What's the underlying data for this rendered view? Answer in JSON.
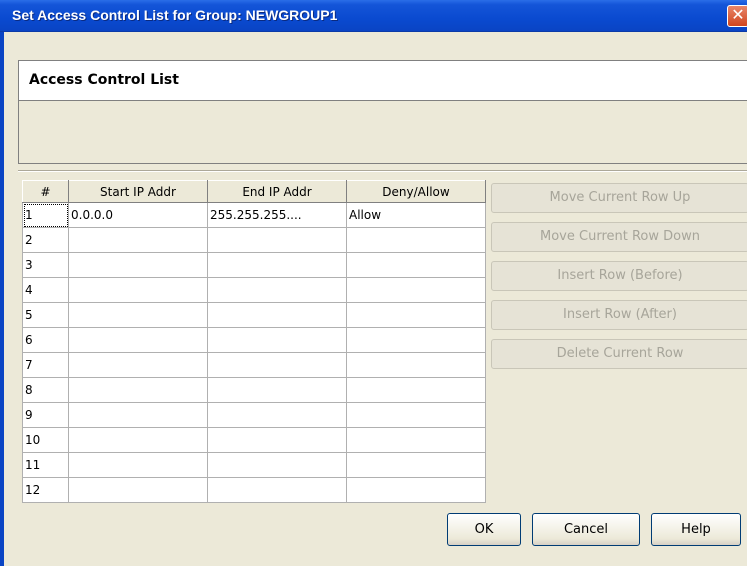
{
  "window": {
    "title": "Set Access Control List for Group: NEWGROUP1",
    "close_glyph": "✕"
  },
  "group": {
    "title": "Access Control List"
  },
  "table": {
    "headers": [
      "#",
      "Start IP Addr",
      "End IP Addr",
      "Deny/Allow"
    ],
    "rows": [
      [
        "1",
        "0.0.0.0",
        "255.255.255....",
        "Allow"
      ],
      [
        "2",
        "",
        "",
        ""
      ],
      [
        "3",
        "",
        "",
        ""
      ],
      [
        "4",
        "",
        "",
        ""
      ],
      [
        "5",
        "",
        "",
        ""
      ],
      [
        "6",
        "",
        "",
        ""
      ],
      [
        "7",
        "",
        "",
        ""
      ],
      [
        "8",
        "",
        "",
        ""
      ],
      [
        "9",
        "",
        "",
        ""
      ],
      [
        "10",
        "",
        "",
        ""
      ],
      [
        "11",
        "",
        "",
        ""
      ],
      [
        "12",
        "",
        "",
        ""
      ]
    ]
  },
  "side_buttons": [
    {
      "label": "Move Current Row Up",
      "enabled": false
    },
    {
      "label": "Move Current Row Down",
      "enabled": false
    },
    {
      "label": "Insert Row (Before)",
      "enabled": false
    },
    {
      "label": "Insert Row (After)",
      "enabled": false
    },
    {
      "label": "Delete Current Row",
      "enabled": false
    }
  ],
  "buttons": {
    "ok": "OK",
    "cancel": "Cancel",
    "help": "Help"
  },
  "colors": {
    "titlebar": "#0a4ad0",
    "dialog_bg": "#ece9d8",
    "close_button": "#d0451f",
    "disabled_text": "#a7a59a"
  }
}
